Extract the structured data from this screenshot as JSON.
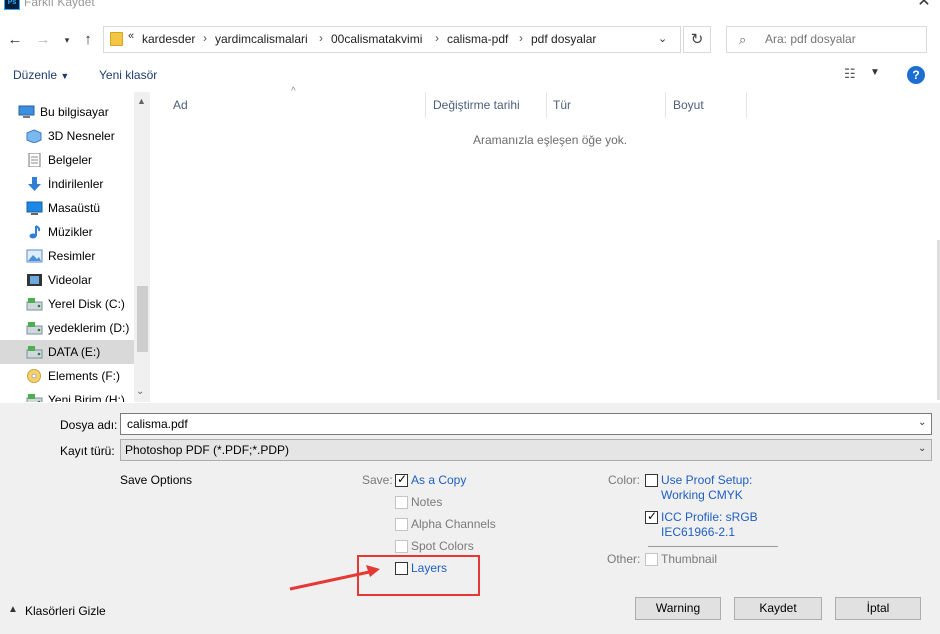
{
  "window": {
    "title": "Farklı Kaydet",
    "app_icon_label": "Ps"
  },
  "nav": {
    "breadcrumb_prefix": "«",
    "breadcrumbs": [
      "kardesder",
      "yardimcalismalari",
      "00calismatakvimi",
      "calisma-pdf",
      "pdf dosyalar"
    ],
    "search_placeholder": "Ara: pdf dosyalar"
  },
  "toolbar": {
    "organize_label": "Düzenle",
    "new_folder_label": "Yeni klasör"
  },
  "sidebar": {
    "items": [
      {
        "label": "Bu bilgisayar",
        "icon": "computer-icon"
      },
      {
        "label": "3D Nesneler",
        "icon": "cube-icon"
      },
      {
        "label": "Belgeler",
        "icon": "documents-icon"
      },
      {
        "label": "İndirilenler",
        "icon": "download-icon"
      },
      {
        "label": "Masaüstü",
        "icon": "desktop-icon"
      },
      {
        "label": "Müzikler",
        "icon": "music-icon"
      },
      {
        "label": "Resimler",
        "icon": "pictures-icon"
      },
      {
        "label": "Videolar",
        "icon": "video-icon"
      },
      {
        "label": "Yerel Disk (C:)",
        "icon": "drive-icon"
      },
      {
        "label": "yedeklerim (D:)",
        "icon": "drive-icon"
      },
      {
        "label": "DATA (E:)",
        "icon": "drive-icon",
        "selected": true
      },
      {
        "label": "Elements (F:)",
        "icon": "dvd-icon"
      },
      {
        "label": "Yeni Birim (H:)",
        "icon": "drive-icon"
      }
    ]
  },
  "file_list": {
    "columns": [
      "Ad",
      "Değiştirme tarihi",
      "Tür",
      "Boyut"
    ],
    "empty_message": "Aramanızla eşleşen öğe yok."
  },
  "form": {
    "filename_label": "Dosya adı:",
    "filename_value": "calisma.pdf",
    "filetype_label": "Kayıt türü:",
    "filetype_value": "Photoshop PDF (*.PDF;*.PDP)"
  },
  "save_options": {
    "title": "Save Options",
    "save_label": "Save:",
    "options": [
      {
        "label": "As a Copy",
        "checked": true,
        "enabled": true
      },
      {
        "label": "Notes",
        "checked": false,
        "enabled": false
      },
      {
        "label": "Alpha Channels",
        "checked": false,
        "enabled": false
      },
      {
        "label": "Spot Colors",
        "checked": false,
        "enabled": false
      },
      {
        "label": "Layers",
        "checked": false,
        "enabled": true
      }
    ],
    "color_label": "Color:",
    "proof_setup_line1": "Use Proof Setup:",
    "proof_setup_line2": "Working CMYK",
    "icc_line1": "ICC Profile:  sRGB",
    "icc_line2": "IEC61966-2.1",
    "other_label": "Other:",
    "thumbnail_label": "Thumbnail"
  },
  "buttons": {
    "warning": "Warning",
    "save": "Kaydet",
    "cancel": "İptal",
    "hide_folders": "Klasörleri Gizle"
  },
  "colors": {
    "link": "#1f5fbf",
    "annotation": "#e53935",
    "selected_bg": "#d9d9d9"
  }
}
